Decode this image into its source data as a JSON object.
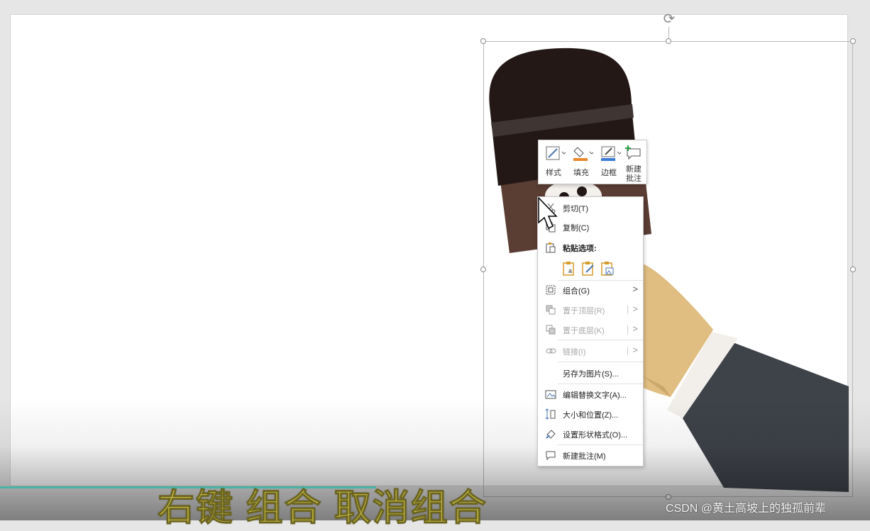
{
  "mini_toolbar": {
    "style_label": "样式",
    "fill_label": "填充",
    "border_label": "边框",
    "new_comment_label_line1": "新建",
    "new_comment_label_line2": "批注"
  },
  "context_menu": {
    "items": [
      {
        "label": "剪切(T)",
        "icon": "scissors-icon"
      },
      {
        "label": "复制(C)",
        "icon": "copy-icon"
      },
      {
        "label": "粘贴选项:",
        "icon": "paste-icon"
      },
      {
        "label": "组合(G)",
        "icon": "group-icon"
      },
      {
        "label": "置于顶层(R)",
        "icon": "bring-to-front-icon"
      },
      {
        "label": "置于底层(K)",
        "icon": "send-to-back-icon"
      },
      {
        "label": "链接(I)",
        "icon": "link-icon"
      },
      {
        "label": "另存为图片(S)...",
        "icon": ""
      },
      {
        "label": "编辑替换文字(A)...",
        "icon": "alt-text-icon"
      },
      {
        "label": "大小和位置(Z)...",
        "icon": "size-position-icon"
      },
      {
        "label": "设置形状格式(O)...",
        "icon": "format-shape-icon"
      },
      {
        "label": "新建批注(M)",
        "icon": "new-comment-icon"
      }
    ]
  },
  "caption": "右键  组合  取消组合",
  "watermark": "CSDN @黄土高坡上的独孤前辈",
  "colors": {
    "mic_head": "#231816",
    "mic_band": "#3f3634",
    "mic_body": "#5a3d33",
    "hand": "#e0bd80",
    "cuff": "#f2efeb",
    "sleeve": "#3e4249",
    "caption": "#c7bb45",
    "progress": "#49b3a6"
  }
}
